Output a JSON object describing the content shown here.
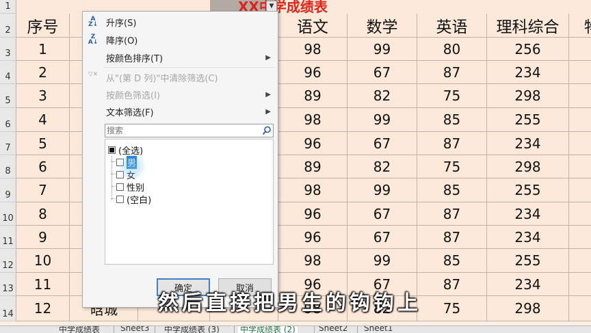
{
  "sheet": {
    "title": "XX中学成绩表",
    "row_numbers": [
      "1",
      "2",
      "3",
      "4",
      "5",
      "6",
      "7",
      "8",
      "9",
      "10",
      "11",
      "12",
      "13",
      "14"
    ],
    "headers": [
      "序号",
      "",
      "",
      "",
      "语文",
      "数学",
      "英语",
      "理科综合",
      "物"
    ],
    "rows": [
      [
        "1",
        "98",
        "99",
        "80",
        "256"
      ],
      [
        "2",
        "96",
        "67",
        "87",
        "234"
      ],
      [
        "3",
        "89",
        "82",
        "75",
        "298"
      ],
      [
        "4",
        "98",
        "99",
        "85",
        "255"
      ],
      [
        "5",
        "96",
        "67",
        "87",
        "234"
      ],
      [
        "6",
        "89",
        "82",
        "75",
        "298"
      ],
      [
        "7",
        "98",
        "99",
        "85",
        "255"
      ],
      [
        "8",
        "96",
        "67",
        "87",
        "234"
      ],
      [
        "9",
        "96",
        "67",
        "87",
        "234"
      ],
      [
        "10",
        "98",
        "99",
        "85",
        "255"
      ],
      [
        "11",
        "96",
        "67",
        "87",
        "234"
      ],
      [
        "12",
        "98",
        "82",
        "75",
        "298"
      ]
    ],
    "visible_name": "晗城",
    "filter_icon": "dropdown-arrow-icon"
  },
  "filter_menu": {
    "sort_asc": "升序(S)",
    "sort_desc": "降序(O)",
    "sort_by_color": "按颜色排序(T)",
    "clear_filter": "从\"(第 D 列)\"中清除筛选(C)",
    "filter_by_color": "按颜色筛选(I)",
    "text_filter": "文本筛选(F)",
    "search_placeholder": "搜索",
    "options": [
      {
        "label": "(全选)",
        "state": "partial"
      },
      {
        "label": "男",
        "state": "checked"
      },
      {
        "label": "女",
        "state": "unchecked"
      },
      {
        "label": "性别",
        "state": "unchecked"
      },
      {
        "label": "(空白)",
        "state": "unchecked"
      }
    ],
    "ok_label": "确定",
    "cancel_label": "取消"
  },
  "tabs": [
    "中学成绩表",
    "Sheet3",
    "中学成绩表 (3)",
    "中学成绩表 (2)",
    "Sheet2",
    "Sheet1"
  ],
  "active_tab": "中学成绩表 (2)",
  "subtitle": "然后直接把男生的钩钩上",
  "colors": {
    "cell_bg": "#fde9d9",
    "title_red": "#e0241b",
    "selection_blue": "#1a73c7"
  }
}
